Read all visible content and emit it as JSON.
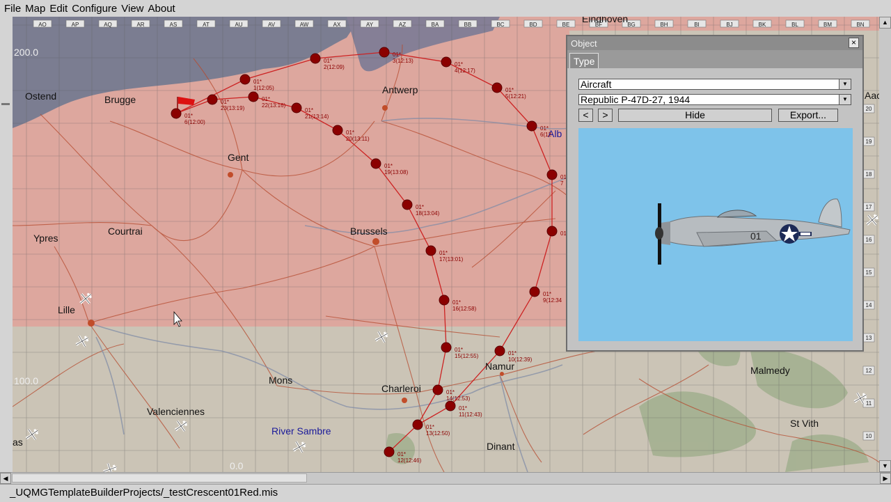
{
  "menu": [
    "File",
    "Map",
    "Edit",
    "Configure",
    "View",
    "About"
  ],
  "map": {
    "grid_columns": [
      "AO",
      "AP",
      "AQ",
      "AR",
      "AS",
      "AT",
      "AU",
      "AV",
      "AW",
      "AX",
      "AY",
      "AZ",
      "BA",
      "BB",
      "BC",
      "BD",
      "BE",
      "BF",
      "BG",
      "BH",
      "BI",
      "BJ",
      "BK",
      "BL",
      "BM",
      "BN"
    ],
    "grid_rows": [
      "20",
      "19",
      "18",
      "17",
      "16",
      "15",
      "14",
      "13",
      "12",
      "11",
      "10"
    ],
    "altitude_labels": [
      "200.0",
      "100.0",
      "0.0"
    ],
    "cities": [
      "Ostend",
      "Brugge",
      "Gent",
      "Antwerp",
      "Courtrai",
      "Ypres",
      "Brussels",
      "Lille",
      "Mons",
      "Charleroi",
      "Namur",
      "Valenciennes",
      "Dinant",
      "Malmedy",
      "St Vith",
      "as",
      "Alb",
      "Eindhoven",
      "Aach"
    ],
    "river_label": "River Sambre",
    "waypoints": [
      {
        "label": "01*",
        "sub": "6(12:00)"
      },
      {
        "label": "01*",
        "sub": "23(13:19)"
      },
      {
        "label": "01*",
        "sub": "1(12:05)"
      },
      {
        "label": "01*",
        "sub": "22(13:16)"
      },
      {
        "label": "01*",
        "sub": "21(13:14)"
      },
      {
        "label": "01*",
        "sub": "2(12:09)"
      },
      {
        "label": "01*",
        "sub": "3(12:13)"
      },
      {
        "label": "01*",
        "sub": "4(12:17)"
      },
      {
        "label": "01*",
        "sub": "5(12:21)"
      },
      {
        "label": "01*",
        "sub": "6(12"
      },
      {
        "label": "01*",
        "sub": "7"
      },
      {
        "label": "01*",
        "sub": "20(13:11)"
      },
      {
        "label": "01*",
        "sub": "19(13:08)"
      },
      {
        "label": "01*",
        "sub": "18(13:04)"
      },
      {
        "label": "01*",
        "sub": "17(13:01)"
      },
      {
        "label": "01*",
        "sub": "16(12:58)"
      },
      {
        "label": "01*",
        "sub": "15(12:55)"
      },
      {
        "label": "01*",
        "sub": "10(12:39)"
      },
      {
        "label": "01*",
        "sub": "14(12:53)"
      },
      {
        "label": "01*",
        "sub": "11(12:43)"
      },
      {
        "label": "01*",
        "sub": "13(12:50)"
      },
      {
        "label": "01*",
        "sub": "12(12:46)"
      },
      {
        "label": "01*",
        "sub": "9(12:34"
      },
      {
        "label": "01*",
        "sub": ""
      }
    ]
  },
  "object_panel": {
    "title": "Object",
    "close": "×",
    "tab": "Type",
    "type_value": "Aircraft",
    "model_value": "Republic P-47D-27, 1944",
    "prev_btn": "<",
    "next_btn": ">",
    "hide_btn": "Hide",
    "export_btn": "Export...",
    "aircraft_code": "01"
  },
  "status": "_UQMGTemplateBuilderProjects/_testCrescent01Red.mis",
  "colors": {
    "friendly_zone": "#dda79e",
    "neutral_zone": "#cbc4b6",
    "sea": "#7b7d91",
    "waypoint": "#8b0000",
    "route": "#cc2222",
    "sky": "#7ec3ea"
  }
}
